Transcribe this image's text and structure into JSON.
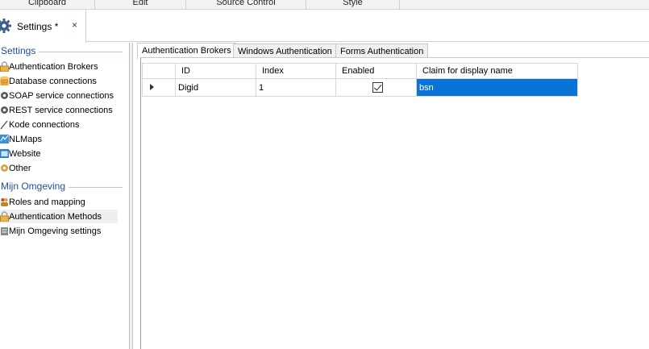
{
  "ribbon": {
    "groups": [
      "Clipboard",
      "Edit",
      "Source Control",
      "Style"
    ]
  },
  "document_tab": {
    "title": "Settings *",
    "close_glyph": "×",
    "icon": "gear-icon"
  },
  "nav": {
    "sections": [
      {
        "header": "Settings",
        "items": [
          {
            "label": "Authentication Brokers",
            "icon": "lock-icon"
          },
          {
            "label": "Database connections",
            "icon": "database-icon"
          },
          {
            "label": "SOAP service connections",
            "icon": "gear-connection-icon"
          },
          {
            "label": "REST service connections",
            "icon": "gear-connection-icon"
          },
          {
            "label": "Kode connections",
            "icon": "pen-icon"
          },
          {
            "label": "NLMaps",
            "icon": "map-icon"
          },
          {
            "label": "Website",
            "icon": "website-icon"
          },
          {
            "label": "Other",
            "icon": "gear-other-icon"
          }
        ]
      },
      {
        "header": "Mijn Omgeving",
        "items": [
          {
            "label": "Roles and mapping",
            "icon": "users-icon"
          },
          {
            "label": "Authentication Methods",
            "icon": "lock-icon",
            "selected": true
          },
          {
            "label": "Mijn Omgeving settings",
            "icon": "settings-icon"
          }
        ]
      }
    ]
  },
  "subtabs": [
    "Authentication Brokers",
    "Windows Authentication",
    "Forms Authentication"
  ],
  "active_subtab": "Authentication Brokers",
  "grid": {
    "columns": [
      "ID",
      "Index",
      "Enabled",
      "Claim for display name"
    ],
    "rows": [
      {
        "id": "Digid",
        "index": "1",
        "enabled": true,
        "claim": "bsn"
      }
    ]
  },
  "colors": {
    "accent": "#1e4f9c",
    "selection": "#0a74d6"
  }
}
